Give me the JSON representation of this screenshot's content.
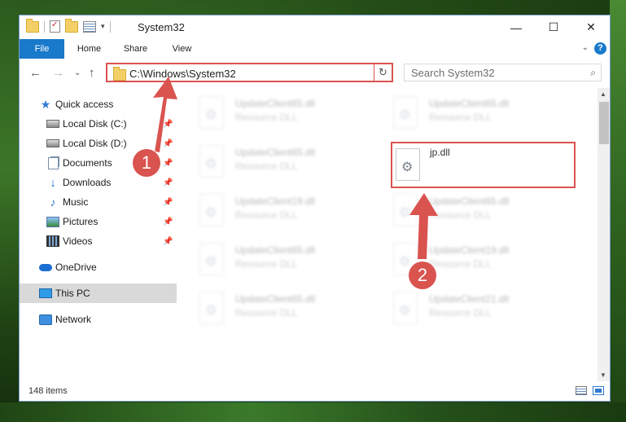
{
  "window": {
    "title": "System32",
    "controls": {
      "minimize": "—",
      "maximize": "☐",
      "close": "✕"
    }
  },
  "ribbon": {
    "tabs": [
      "File",
      "Home",
      "Share",
      "View"
    ],
    "help": "?"
  },
  "navigation": {
    "address": "C:\\Windows\\System32",
    "search_placeholder": "Search System32"
  },
  "sidebar": {
    "quick_access": "Quick access",
    "items": [
      {
        "label": "Local Disk (C:)",
        "icon": "disk-icon",
        "pinned": true
      },
      {
        "label": "Local Disk (D:)",
        "icon": "disk-icon",
        "pinned": true
      },
      {
        "label": "Documents",
        "icon": "documents-icon",
        "pinned": true
      },
      {
        "label": "Downloads",
        "icon": "download-icon",
        "pinned": true
      },
      {
        "label": "Music",
        "icon": "music-icon",
        "pinned": true
      },
      {
        "label": "Pictures",
        "icon": "pictures-icon",
        "pinned": true
      },
      {
        "label": "Videos",
        "icon": "videos-icon",
        "pinned": true
      }
    ],
    "onedrive": "OneDrive",
    "this_pc": "This PC",
    "network": "Network"
  },
  "files": {
    "column1": [
      {
        "name": "UpdateClient65.dll",
        "type": "Resource DLL"
      },
      {
        "name": "UpdateClient65.dll",
        "type": "Resource DLL"
      },
      {
        "name": "UpdateClient19.dll",
        "type": "Resource DLL"
      },
      {
        "name": "UpdateClient65.dll",
        "type": "Resource DLL"
      },
      {
        "name": "UpdateClient65.dll",
        "type": "Resource DLL"
      }
    ],
    "column2": [
      {
        "name": "UpdateClient65.dll",
        "type": "Resource DLL"
      },
      {
        "name": "jp.dll",
        "type": ""
      },
      {
        "name": "UpdateClient65.dll",
        "type": "Resource DLL"
      },
      {
        "name": "UpdateClient19.dll",
        "type": "Resource DLL"
      },
      {
        "name": "UpdateClient21.dll",
        "type": "Resource DLL"
      }
    ]
  },
  "status": {
    "item_count": "148 items"
  },
  "annotations": {
    "step1": "1",
    "step2": "2",
    "color": "#d9534f"
  }
}
